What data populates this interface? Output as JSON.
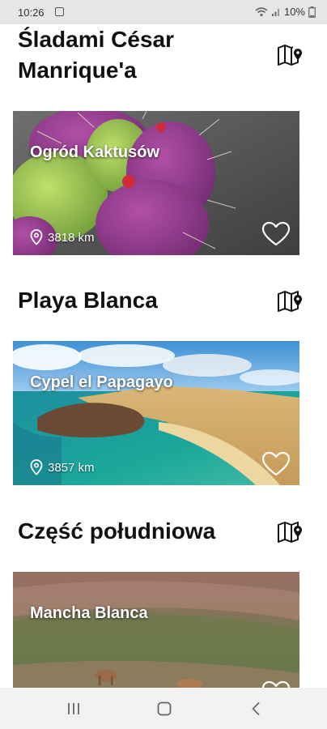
{
  "status": {
    "time": "10:26",
    "battery": "10%"
  },
  "sections": [
    {
      "title": "Śladami César Manrique'a",
      "card": {
        "name": "Ogród Kaktusów",
        "distance": "3818 km"
      }
    },
    {
      "title": "Playa Blanca",
      "card": {
        "name": "Cypel el Papagayo",
        "distance": "3857 km"
      }
    },
    {
      "title": "Część południowa",
      "card": {
        "name": "Mancha Blanca"
      }
    }
  ],
  "icons": {
    "map": "map-pin-icon",
    "favorite": "heart-outline-icon",
    "location": "location-pin-icon",
    "nav_recent": "recent-apps-icon",
    "nav_home": "home-icon",
    "nav_back": "back-icon"
  }
}
